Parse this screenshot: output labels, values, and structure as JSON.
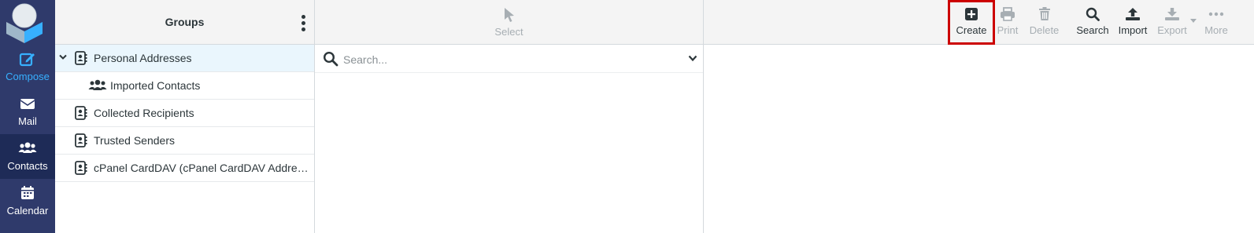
{
  "nav": {
    "compose": "Compose",
    "mail": "Mail",
    "contacts": "Contacts",
    "calendar": "Calendar"
  },
  "groups": {
    "title": "Groups",
    "items": [
      {
        "label": "Personal Addresses",
        "icon": "address-book-icon",
        "selected": true,
        "expanded": true
      },
      {
        "label": "Imported Contacts",
        "icon": "users-icon",
        "child": true
      },
      {
        "label": "Collected Recipients",
        "icon": "address-book-icon"
      },
      {
        "label": "Trusted Senders",
        "icon": "address-book-icon"
      },
      {
        "label": "cPanel CardDAV (cPanel CardDAV Address…",
        "icon": "address-book-icon"
      }
    ]
  },
  "list": {
    "select_label": "Select",
    "search_placeholder": "Search..."
  },
  "toolbar": {
    "create": "Create",
    "print": "Print",
    "delete": "Delete",
    "search": "Search",
    "import": "Import",
    "export": "Export",
    "more": "More"
  },
  "colors": {
    "nav_bg": "#2f3a6b",
    "accent": "#37b0ff",
    "highlight_border": "#cc0000",
    "selected_row": "#eaf6fd"
  }
}
